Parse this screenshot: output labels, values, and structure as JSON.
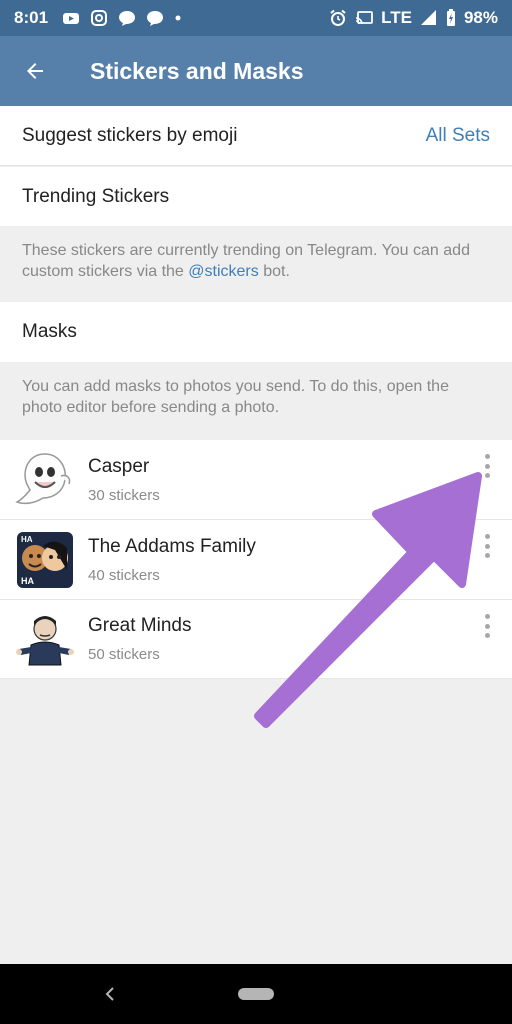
{
  "status_bar": {
    "time": "8:01",
    "network": "LTE",
    "battery": "98%"
  },
  "app_bar": {
    "title": "Stickers and Masks"
  },
  "suggest": {
    "label": "Suggest stickers by emoji",
    "value": "All Sets"
  },
  "trending": {
    "label": "Trending Stickers"
  },
  "trending_info": {
    "text_before": "These stickers are currently trending on Telegram. You can add custom stickers via the ",
    "link": "@stickers",
    "text_after": " bot."
  },
  "masks": {
    "label": "Masks",
    "info": "You can add masks to photos you send. To do this, open the photo editor before sending a photo."
  },
  "sets": [
    {
      "name": "Casper",
      "count": "30 stickers",
      "icon": "ghost-icon"
    },
    {
      "name": "The Addams Family",
      "count": "40 stickers",
      "icon": "addams-family-icon"
    },
    {
      "name": "Great Minds",
      "count": "50 stickers",
      "icon": "great-minds-icon"
    }
  ],
  "colors": {
    "header": "#5680aa",
    "status": "#3e6a93",
    "accent": "#3e7fb8",
    "arrow": "#a66fd4"
  }
}
